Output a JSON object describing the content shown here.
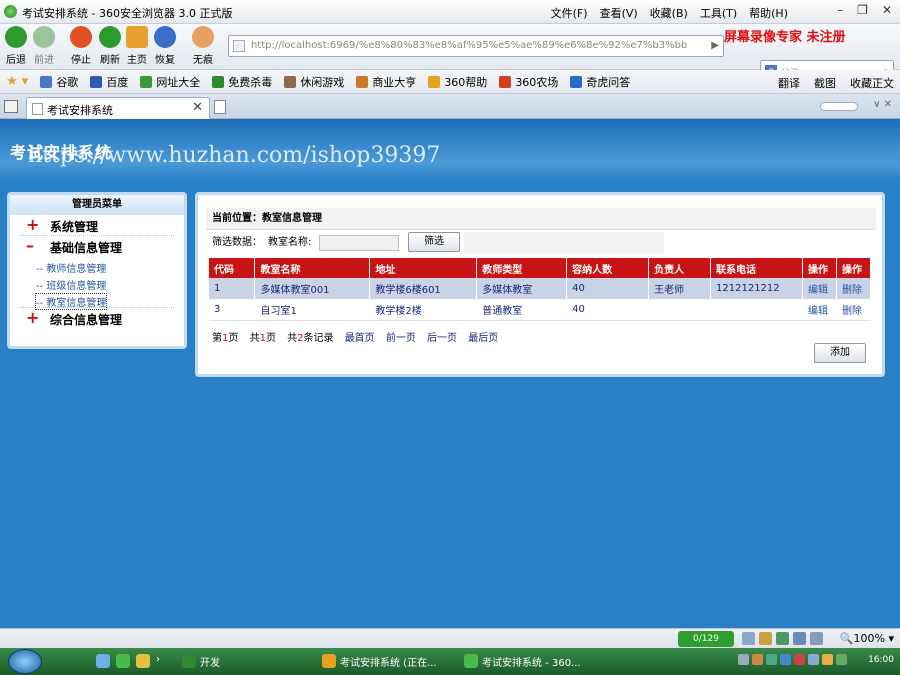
{
  "window": {
    "title": "考试安排系统 - 360安全浏览器 3.0 正式版",
    "controls": [
      "–",
      "❐",
      "✕"
    ]
  },
  "menu": [
    "文件(F)",
    "查看(V)",
    "收藏(B)",
    "工具(T)",
    "帮助(H)"
  ],
  "nav": {
    "buttons": [
      {
        "label": "后退",
        "icon": "back-arrow-icon",
        "color": "#2e9a2e"
      },
      {
        "label": "前进",
        "icon": "forward-arrow-icon",
        "color": "#9ac49a"
      },
      {
        "label": "停止",
        "icon": "stop-icon",
        "color": "#e05020"
      },
      {
        "label": "刷新",
        "icon": "refresh-icon",
        "color": "#2e9a2e"
      },
      {
        "label": "主页",
        "icon": "home-icon",
        "color": "#e8a030"
      },
      {
        "label": "恢复",
        "icon": "undo-icon",
        "color": "#3a6ec8"
      },
      {
        "label": "无痕",
        "icon": "incognito-icon",
        "color": "#e8a060"
      }
    ]
  },
  "address": {
    "url": "http://localhost:6969/%e8%80%83%e8%af%95%e5%ae%89%e6%8e%92%e7%b3%bb",
    "go": "▶"
  },
  "recorder_watermark": "屏幕录像专家  未注册",
  "search": {
    "placeholder": "谷歌"
  },
  "favorites": [
    {
      "label": "谷歌",
      "color": "#4a78c8"
    },
    {
      "label": "百度",
      "color": "#2a5ab8"
    },
    {
      "label": "网址大全",
      "color": "#3a9a3a"
    },
    {
      "label": "免费杀毒",
      "color": "#2e8a2e"
    },
    {
      "label": "休闲游戏",
      "color": "#8a6a4a"
    },
    {
      "label": "商业大亨",
      "color": "#c87a2a"
    },
    {
      "label": "360帮助",
      "color": "#e8a020"
    },
    {
      "label": "360农场",
      "color": "#d04020"
    },
    {
      "label": "奇虎问答",
      "color": "#2a6ac8"
    }
  ],
  "favorites_right": [
    "翻译",
    "截图",
    "收藏正文"
  ],
  "tab": {
    "title": "考试安排系统",
    "close": "✕"
  },
  "page": {
    "system_title": "考试安排系统",
    "overlay_watermark": "https://www.huzhan.com/ishop39397",
    "sidebar": {
      "header": "管理员菜单",
      "groups": [
        {
          "sign": "+",
          "label": "系统管理",
          "items": []
        },
        {
          "sign": "–",
          "label": "基础信息管理",
          "items": [
            "-- 教师信息管理",
            "-- 班级信息管理",
            "-- 教室信息管理"
          ]
        },
        {
          "sign": "+",
          "label": "综合信息管理",
          "items": []
        }
      ]
    },
    "breadcrumb": "当前位置：教室信息管理",
    "filter": {
      "label": "筛选数据：",
      "field_label": "教室名称:",
      "field_value": "",
      "button": "筛选"
    },
    "table": {
      "headers": [
        "代码",
        "教室名称",
        "地址",
        "教师类型",
        "容纳人数",
        "负责人",
        "联系电话",
        "操作",
        "操作"
      ],
      "rows": [
        [
          "1",
          "多媒体教室001",
          "教学楼6楼601",
          "多媒体教室",
          "40",
          "王老师",
          "1212121212",
          "编辑",
          "删除"
        ],
        [
          "3",
          "自习室1",
          "教学楼2楼",
          "普通教室",
          "40",
          "",
          "",
          "编辑",
          "删除"
        ]
      ]
    },
    "pager": {
      "page_prefix": "第",
      "page": "1",
      "page_suffix": "页",
      "total_prefix": "共",
      "total_pages": "1",
      "total_suffix": "页",
      "records_prefix": "共",
      "records": "2",
      "records_suffix": "条记录",
      "links": [
        "最首页",
        "前一页",
        "后一页",
        "最后页"
      ]
    },
    "add_button": "添加"
  },
  "statusbar": {
    "badge": "0/129",
    "zoom": "🔍100% ▾"
  },
  "taskbar": {
    "items": [
      "开发",
      "考试安排系统 (正在...",
      "考试安排系统 - 360..."
    ],
    "time": "16:00"
  }
}
